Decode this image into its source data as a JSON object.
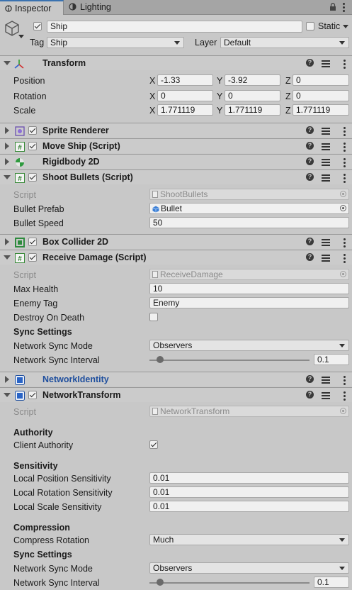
{
  "tabs": [
    {
      "label": "Inspector"
    },
    {
      "label": "Lighting"
    }
  ],
  "object": {
    "name": "Ship",
    "static_label": "Static",
    "tag_label": "Tag",
    "tag_value": "Ship",
    "layer_label": "Layer",
    "layer_value": "Default"
  },
  "transform": {
    "title": "Transform",
    "rows": [
      {
        "label": "Position",
        "x": "-1.33",
        "y": "-3.92",
        "z": "0"
      },
      {
        "label": "Rotation",
        "x": "0",
        "y": "0",
        "z": "0"
      },
      {
        "label": "Scale",
        "x": "1.771119",
        "y": "1.771119",
        "z": "1.771119"
      }
    ],
    "axis": {
      "x": "X",
      "y": "Y",
      "z": "Z"
    }
  },
  "components": {
    "sprite_renderer": "Sprite Renderer",
    "move_ship": "Move Ship (Script)",
    "rigidbody": "Rigidbody 2D",
    "shoot_bullets": "Shoot Bullets (Script)",
    "box_collider": "Box Collider 2D",
    "receive_damage": "Receive Damage (Script)",
    "network_identity": "NetworkIdentity",
    "network_transform": "NetworkTransform"
  },
  "shoot": {
    "script_label": "Script",
    "script_value": "ShootBullets",
    "prefab_label": "Bullet Prefab",
    "prefab_value": "Bullet",
    "speed_label": "Bullet Speed",
    "speed_value": "50"
  },
  "damage": {
    "script_label": "Script",
    "script_value": "ReceiveDamage",
    "max_health_label": "Max Health",
    "max_health_value": "10",
    "enemy_tag_label": "Enemy Tag",
    "enemy_tag_value": "Enemy",
    "destroy_label": "Destroy On Death",
    "sync_header": "Sync Settings",
    "sync_mode_label": "Network Sync Mode",
    "sync_mode_value": "Observers",
    "sync_interval_label": "Network Sync Interval",
    "sync_interval_value": "0.1"
  },
  "ntransform": {
    "script_label": "Script",
    "script_value": "NetworkTransform",
    "authority_header": "Authority",
    "client_authority_label": "Client Authority",
    "sensitivity_header": "Sensitivity",
    "pos_sens_label": "Local Position Sensitivity",
    "pos_sens_value": "0.01",
    "rot_sens_label": "Local Rotation Sensitivity",
    "rot_sens_value": "0.01",
    "scale_sens_label": "Local Scale Sensitivity",
    "scale_sens_value": "0.01",
    "compression_header": "Compression",
    "compress_rot_label": "Compress Rotation",
    "compress_rot_value": "Much",
    "sync_header": "Sync Settings",
    "sync_mode_label": "Network Sync Mode",
    "sync_mode_value": "Observers",
    "sync_interval_label": "Network Sync Interval",
    "sync_interval_value": "0.1"
  },
  "help_glyph": "?",
  "colors": {
    "accent": "#3a72b0",
    "panel": "#c8c8c8",
    "header": "#cbcbcb",
    "network_identity": "#1f4f9e"
  }
}
